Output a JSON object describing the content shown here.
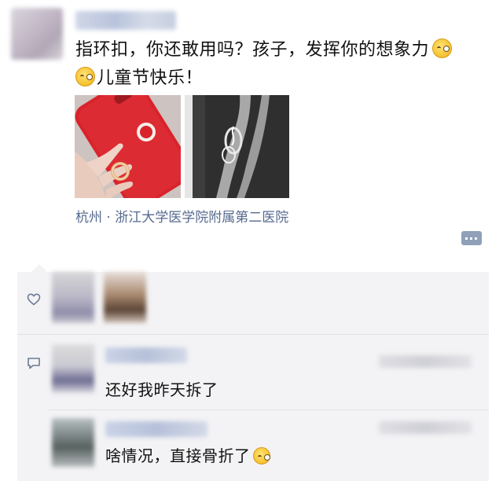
{
  "post": {
    "text_line1": "指环扣，你还敢用吗？孩子，发挥你的想象力",
    "text_line2": "儿童节快乐！",
    "location": "杭州 · 浙江大学医学院附属第二医院"
  },
  "comments": [
    {
      "text": "还好我昨天拆了"
    },
    {
      "text": "啥情况，直接骨折了"
    }
  ],
  "colors": {
    "link": "#566a8f",
    "panel_bg": "#f3f3f5",
    "phone_red": "#d9232c",
    "ring_gold": "#e2b07c"
  }
}
